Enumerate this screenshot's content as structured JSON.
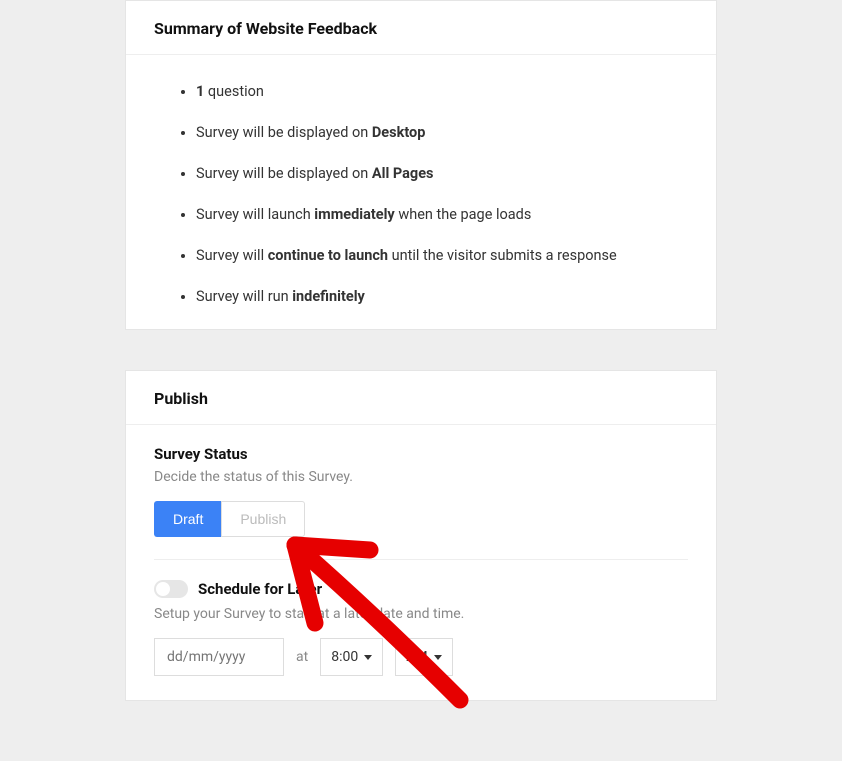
{
  "summary": {
    "title": "Summary of Website Feedback",
    "items": [
      {
        "prefix": "",
        "bold": "1",
        "suffix": " question"
      },
      {
        "prefix": "Survey will be displayed on ",
        "bold": "Desktop",
        "suffix": ""
      },
      {
        "prefix": "Survey will be displayed on ",
        "bold": "All Pages",
        "suffix": ""
      },
      {
        "prefix": "Survey will launch ",
        "bold": "immediately",
        "suffix": " when the page loads"
      },
      {
        "prefix": "Survey will ",
        "bold": "continue to launch",
        "suffix": " until the visitor submits a response"
      },
      {
        "prefix": "Survey will run ",
        "bold": "indefinitely",
        "suffix": ""
      }
    ]
  },
  "publish": {
    "title": "Publish",
    "status": {
      "title": "Survey Status",
      "desc": "Decide the status of this Survey.",
      "draft": "Draft",
      "publish": "Publish"
    },
    "schedule": {
      "title": "Schedule for Later",
      "desc": "Setup your Survey to start at a later date and time.",
      "date_placeholder": "dd/mm/yyyy",
      "at": "at",
      "time": "8:00",
      "ampm": "AM"
    }
  }
}
